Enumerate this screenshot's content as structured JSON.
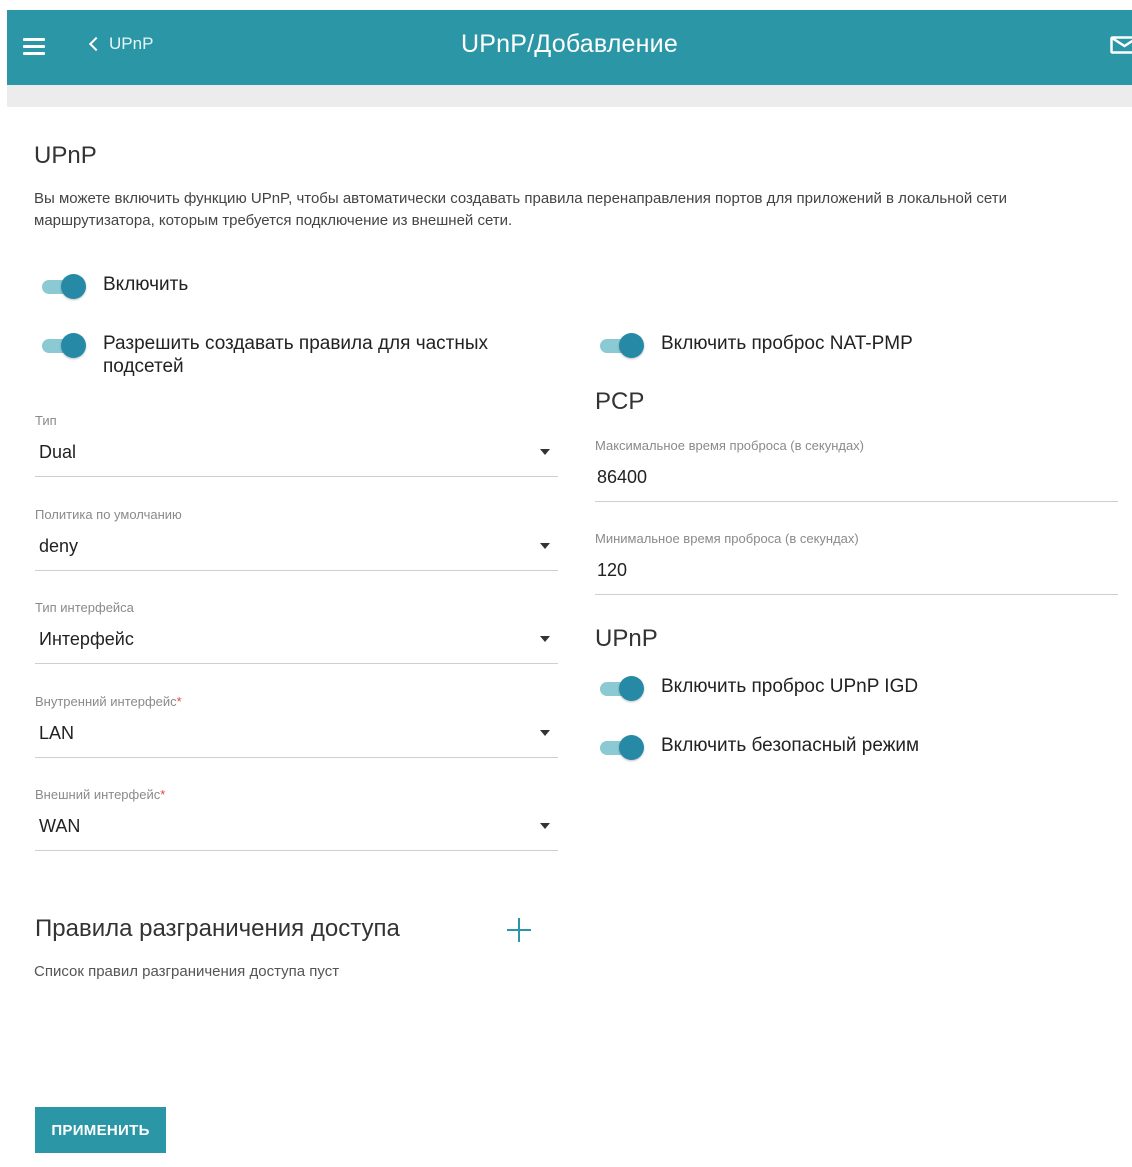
{
  "header": {
    "back_label": "UPnP",
    "title": "UPnP/Добавление"
  },
  "upnp": {
    "title": "UPnP",
    "description": "Вы можете включить функцию UPnP, чтобы автоматически создавать правила перенаправления портов для приложений в локальной сети маршрутизатора, которым требуется подключение из внешней сети.",
    "enable_label": "Включить",
    "enable_on": true,
    "private_subnets_label": "Разрешить создавать правила для частных подсетей",
    "private_subnets_on": true
  },
  "left_fields": {
    "type": {
      "label": "Тип",
      "value": "Dual"
    },
    "default_policy": {
      "label": "Политика по умолчанию",
      "value": "deny"
    },
    "interface_type": {
      "label": "Тип интерфейса",
      "value": "Интерфейс"
    },
    "internal_interface": {
      "label": "Внутренний интерфейс",
      "required": "*",
      "value": "LAN"
    },
    "external_interface": {
      "label": "Внешний интерфейс",
      "required": "*",
      "value": "WAN"
    }
  },
  "nat_pmp": {
    "label": "Включить проброс NAT-PMP",
    "on": true
  },
  "pcp": {
    "title": "PCP",
    "max_time_label": "Максимальное время проброса (в секундах)",
    "max_time_value": "86400",
    "min_time_label": "Минимальное время проброса (в секундах)",
    "min_time_value": "120"
  },
  "upnp_right": {
    "title": "UPnP",
    "igd_label": "Включить проброс UPnP IGD",
    "igd_on": true,
    "secure_label": "Включить безопасный режим",
    "secure_on": true
  },
  "access_rules": {
    "title": "Правила разграничения доступа",
    "empty_text": "Список правил разграничения доступа пуст"
  },
  "apply_label": "ПРИМЕНИТЬ",
  "colors": {
    "accent": "#2b97a6",
    "toggle_knob": "#2689a6",
    "toggle_track": "#8ccad3",
    "required": "#e5483b"
  }
}
